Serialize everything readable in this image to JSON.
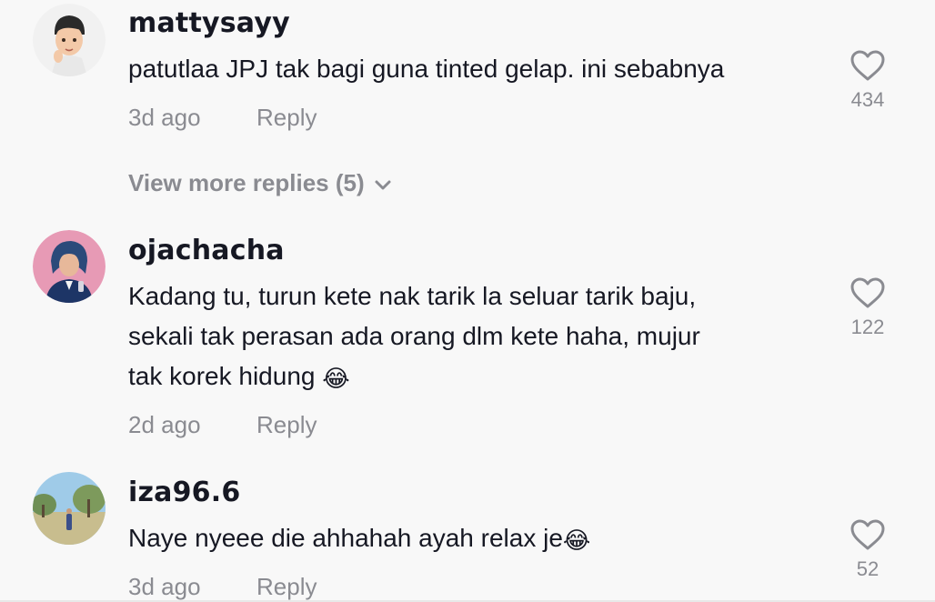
{
  "comments": [
    {
      "username": "mattysayy",
      "text_lines": [
        "patutlaa JPJ tak bagi guna tinted gelap. ini sebabnya"
      ],
      "time": "3d ago",
      "reply_label": "Reply",
      "likes": "434",
      "view_more_label": "View more replies (5)"
    },
    {
      "username": "ojachacha",
      "text_lines": [
        "Kadang tu, turun kete nak tarik la seluar tarik baju,",
        "sekali tak perasan ada orang dlm kete haha, mujur",
        "tak korek hidung"
      ],
      "emoji": "😂",
      "time": "2d ago",
      "reply_label": "Reply",
      "likes": "122"
    },
    {
      "username": "iza96.6",
      "text_lines": [
        "Naye nyeee die ahhahah ayah relax je"
      ],
      "emoji": "😂",
      "time": "3d ago",
      "reply_label": "Reply",
      "likes": "52"
    }
  ],
  "icons": {
    "like": "heart-outline-icon",
    "expand": "chevron-down-icon"
  },
  "colors": {
    "background": "#f8f8f8",
    "primary_text": "#161823",
    "secondary_text": "#8a8b91"
  }
}
